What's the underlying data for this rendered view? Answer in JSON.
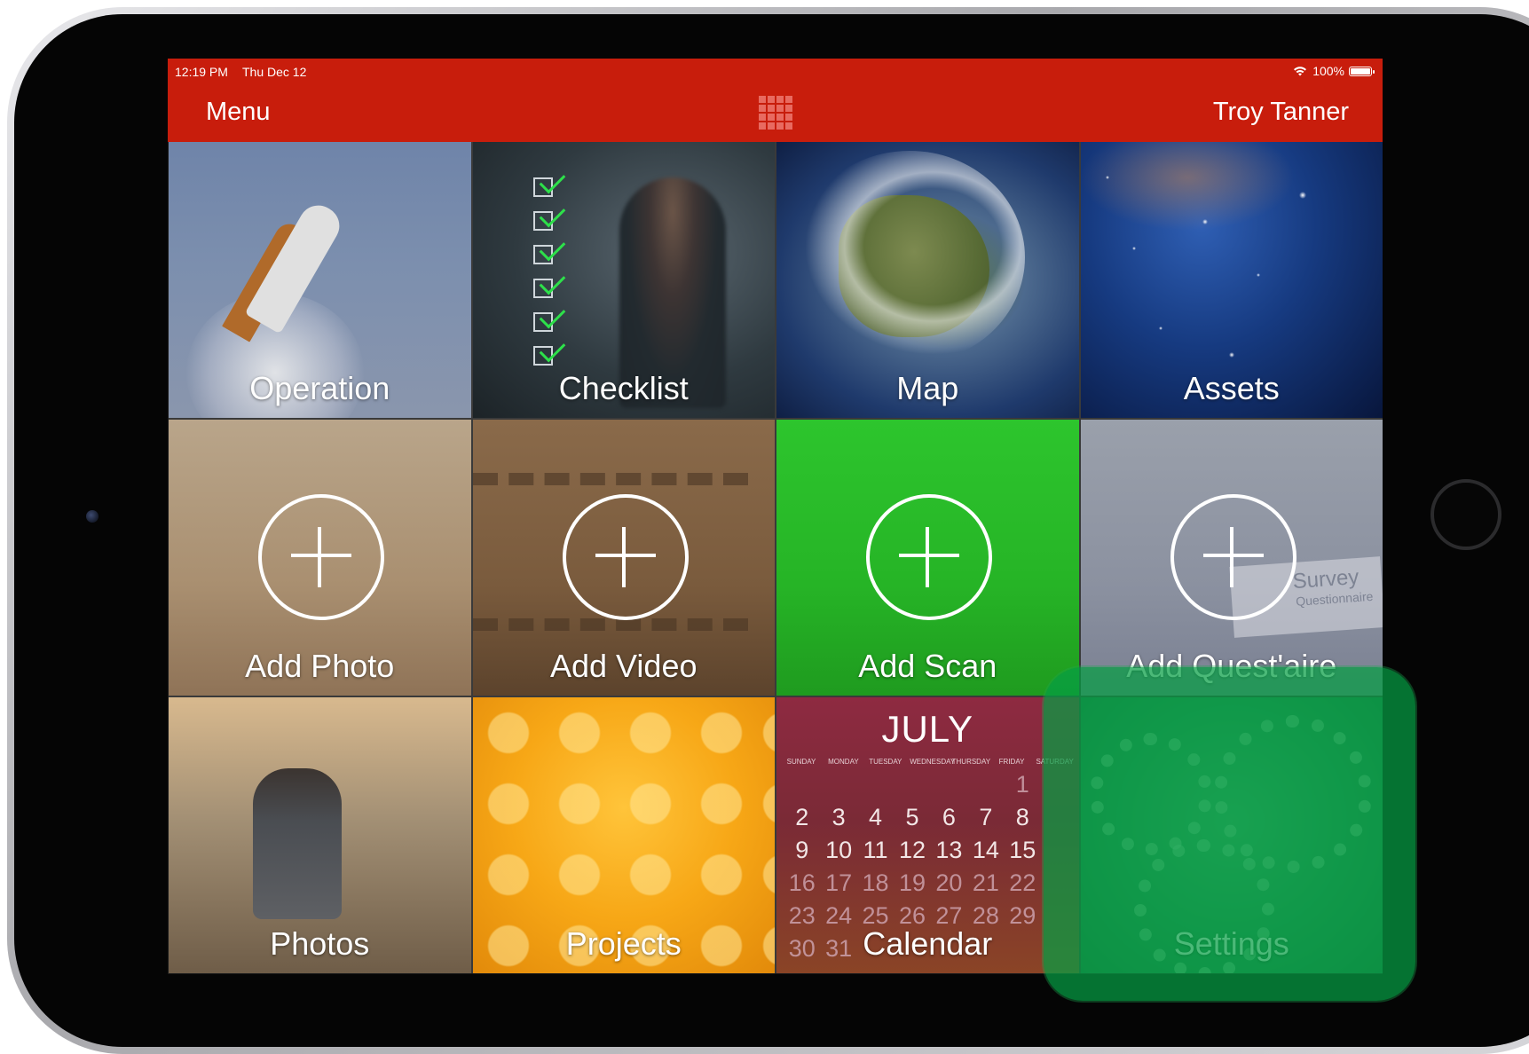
{
  "status_bar": {
    "time": "12:19 PM",
    "date": "Thu Dec 12",
    "battery": "100%"
  },
  "nav": {
    "menu_label": "Menu",
    "user_name": "Troy Tanner",
    "center_icon": "grid-icon"
  },
  "tiles": [
    {
      "label": "Operation"
    },
    {
      "label": "Checklist"
    },
    {
      "label": "Map"
    },
    {
      "label": "Assets"
    },
    {
      "label": "Add Photo"
    },
    {
      "label": "Add Video"
    },
    {
      "label": "Add Scan"
    },
    {
      "label": "Add Quest'aire"
    },
    {
      "label": "Photos"
    },
    {
      "label": "Projects"
    },
    {
      "label": "Calendar"
    },
    {
      "label": "Settings"
    }
  ],
  "calendar": {
    "month": "JULY",
    "weekdays": [
      "SUNDAY",
      "MONDAY",
      "TUESDAY",
      "WEDNESDAY",
      "THURSDAY",
      "FRIDAY",
      "SATURDAY"
    ],
    "rows": [
      [
        "",
        "",
        "",
        "",
        "",
        "",
        "1"
      ],
      [
        "2",
        "3",
        "4",
        "5",
        "6",
        "7",
        "8"
      ],
      [
        "9",
        "10",
        "11",
        "12",
        "13",
        "14",
        "15"
      ],
      [
        "16",
        "17",
        "18",
        "19",
        "20",
        "21",
        "22"
      ],
      [
        "23",
        "24",
        "25",
        "26",
        "27",
        "28",
        "29"
      ],
      [
        "30",
        "31",
        "",
        "",
        "",
        "",
        ""
      ]
    ]
  },
  "scan_overlay_text": {
    "title": "Survey",
    "subtitle": "Questionnaire"
  },
  "colors": {
    "nav_red": "#c81d0c",
    "highlight_green": "#069e44",
    "scan_green": "#2dc52d"
  }
}
